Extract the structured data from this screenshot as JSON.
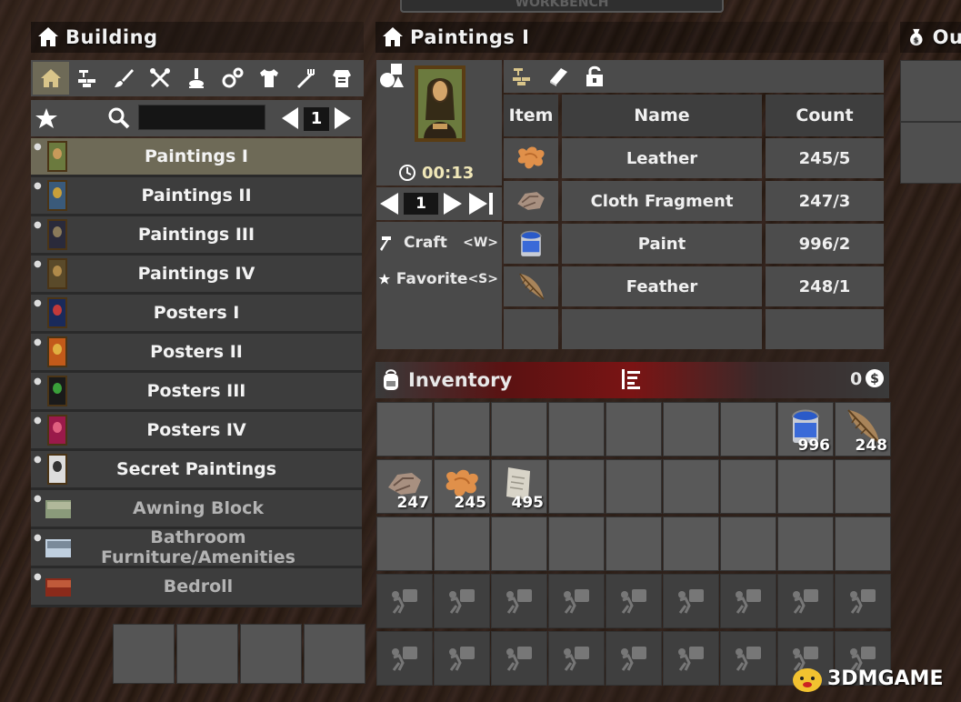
{
  "top_banner": "WORKBENCH",
  "building": {
    "title": "Building",
    "page": "1",
    "search_value": "",
    "categories": [
      "home-icon",
      "bricks-icon",
      "paint-brush-icon",
      "tools-icon",
      "science-icon",
      "gears-icon",
      "shirt-icon",
      "fork-icon",
      "armor-icon"
    ],
    "recipes": [
      {
        "label": "Paintings I",
        "selected": true,
        "dim": false
      },
      {
        "label": "Paintings II",
        "selected": false,
        "dim": false
      },
      {
        "label": "Paintings III",
        "selected": false,
        "dim": false
      },
      {
        "label": "Paintings IV",
        "selected": false,
        "dim": false
      },
      {
        "label": "Posters I",
        "selected": false,
        "dim": false
      },
      {
        "label": "Posters II",
        "selected": false,
        "dim": false
      },
      {
        "label": "Posters III",
        "selected": false,
        "dim": false
      },
      {
        "label": "Posters IV",
        "selected": false,
        "dim": false
      },
      {
        "label": "Secret Paintings",
        "selected": false,
        "dim": false
      },
      {
        "label": "Awning Block",
        "selected": false,
        "dim": true
      },
      {
        "label": "Bathroom Furniture/Amenities",
        "selected": false,
        "dim": true
      },
      {
        "label": "Bedroll",
        "selected": false,
        "dim": true
      }
    ]
  },
  "detail": {
    "title": "Paintings I",
    "craft_time": "00:13",
    "quantity": "1",
    "craft_label": "Craft",
    "craft_key": "<W>",
    "favorite_label": "Favorite",
    "favorite_key": "<S>",
    "table_headers": {
      "item": "Item",
      "name": "Name",
      "count": "Count"
    },
    "ingredients": [
      {
        "name": "Leather",
        "count": "245/5",
        "icon": "leather-icon"
      },
      {
        "name": "Cloth Fragment",
        "count": "247/3",
        "icon": "cloth-icon"
      },
      {
        "name": "Paint",
        "count": "996/2",
        "icon": "paint-can-icon"
      },
      {
        "name": "Feather",
        "count": "248/1",
        "icon": "feather-icon"
      }
    ]
  },
  "output": {
    "title": "Out"
  },
  "inventory": {
    "title": "Inventory",
    "currency": "0",
    "items": [
      {
        "slot": 7,
        "icon": "paint-can-icon",
        "qty": "996"
      },
      {
        "slot": 8,
        "icon": "feather-icon",
        "qty": "248"
      },
      {
        "slot": 9,
        "icon": "cloth-icon",
        "qty": "247"
      },
      {
        "slot": 10,
        "icon": "leather-icon",
        "qty": "245"
      },
      {
        "slot": 11,
        "icon": "paper-icon",
        "qty": "495"
      }
    ]
  },
  "watermark": "3DMGAME",
  "colors": {
    "selected_row": "#6e6a57",
    "panel": "#3d3d3d",
    "slot": "#595959",
    "accent_red": "#7a1414"
  }
}
